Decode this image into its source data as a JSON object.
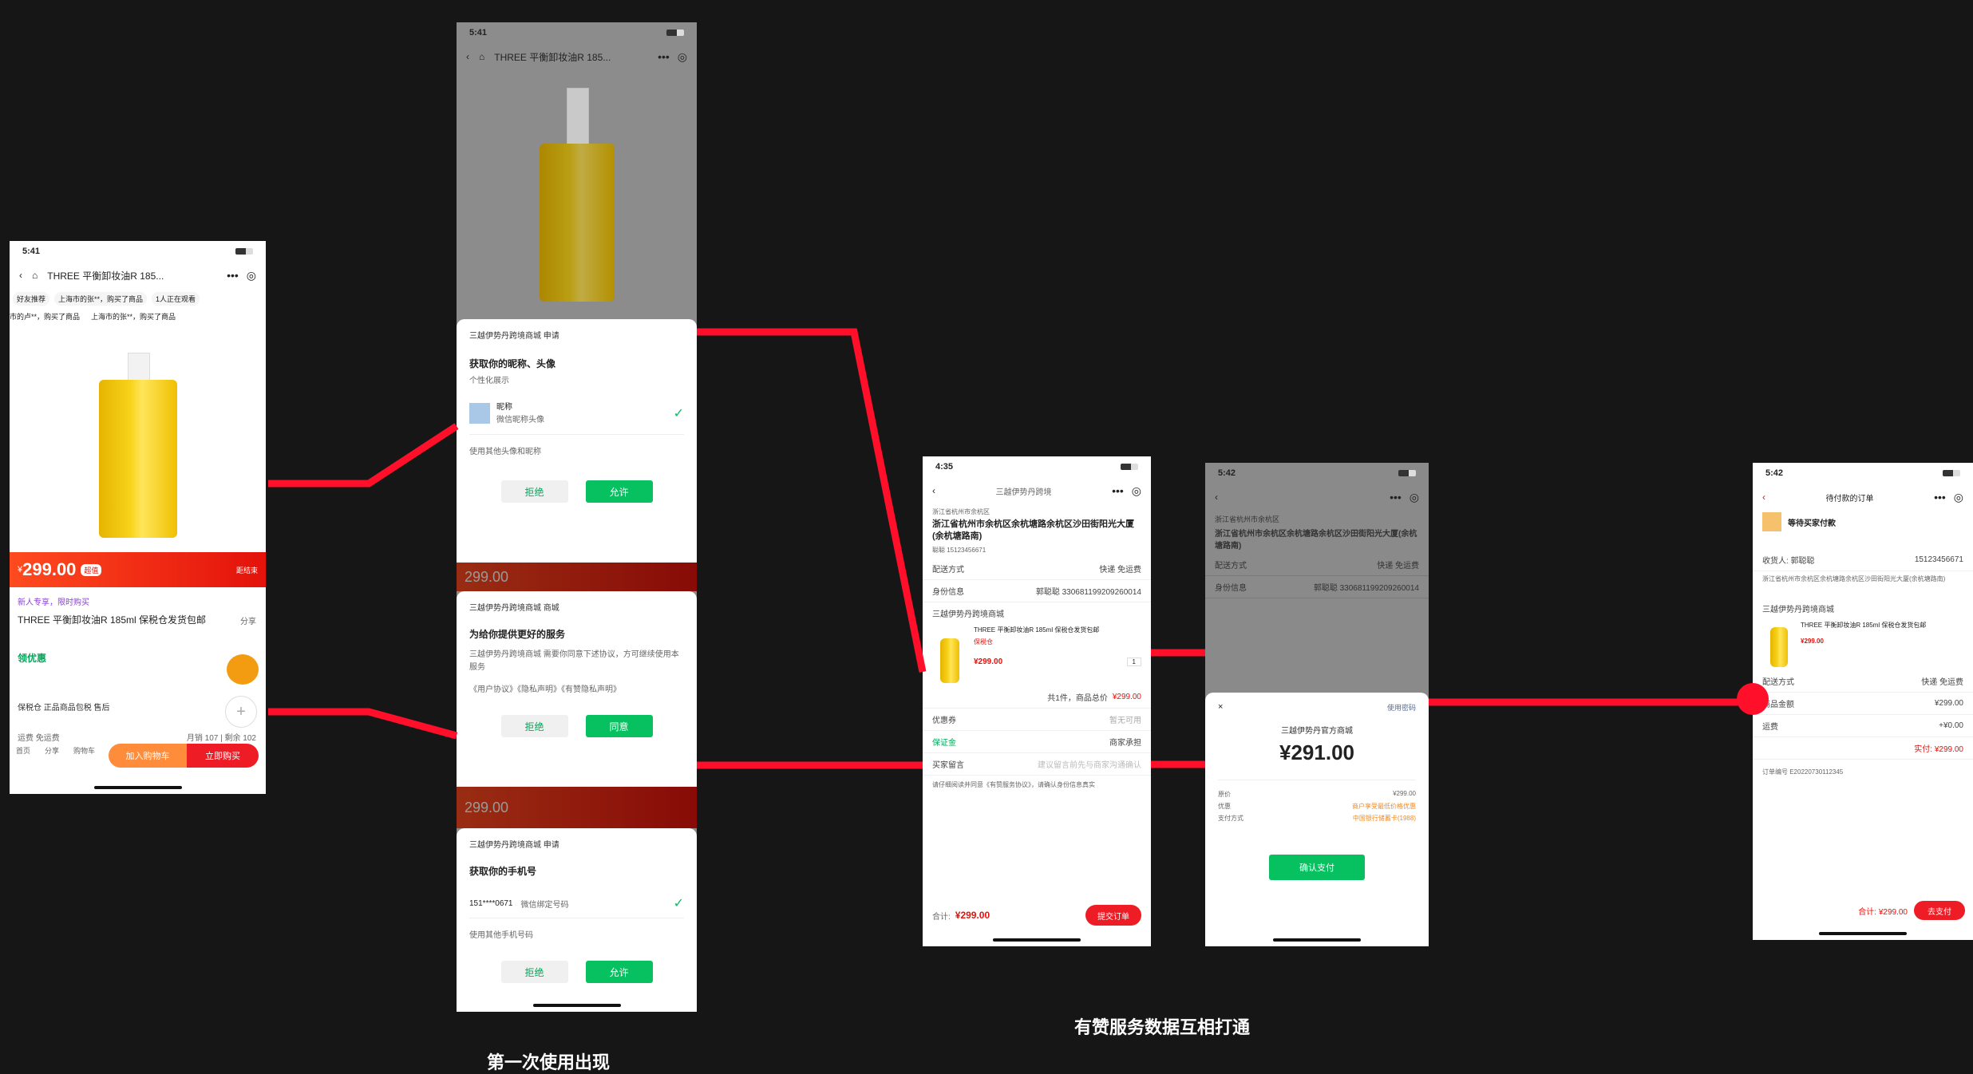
{
  "captions": {
    "first_use": "第一次使用出现",
    "data_sync": "有赞服务数据互相打通"
  },
  "colors": {
    "background": "#161616",
    "connector": "#ff0f2a",
    "brand_red": "#ee1c25",
    "wechat_green": "#07c160"
  },
  "product_page": {
    "time": "5:41",
    "title": "THREE 平衡卸妆油R 185...",
    "tags": [
      "好友推荐",
      "上海市的张**，购买了商品",
      "1人正在观看"
    ],
    "tags2": [
      "市的卢**，购买了商品",
      "上海市的张**，购买了商品"
    ],
    "price": "299.00",
    "price_badge": "超值",
    "countdown": "距结束",
    "product_name": "THREE 平衡卸妆油R 185ml 保税仓发货包邮",
    "share": "分享",
    "promo_label": "新人专享，限时购买",
    "coupon": "领优惠",
    "service": "保税仓 正品商品包税 售后",
    "express": "运费 免运费",
    "stats": "月销 107 | 剩余 102",
    "add_cart": "加入购物车",
    "buy_now": "立即购买",
    "bottom_icons": [
      "首页",
      "分享",
      "购物车"
    ]
  },
  "auth_sheet1": {
    "shop": "三越伊势丹跨境商城 申请",
    "title": "获取你的昵称、头像",
    "subtitle": "个性化展示",
    "user_name": "昵称",
    "user_desc": "微信昵称头像",
    "other": "使用其他头像和昵称",
    "deny": "拒绝",
    "allow": "允许"
  },
  "auth_sheet2": {
    "shop": "三越伊势丹跨境商城 商城",
    "title": "为给你提供更好的服务",
    "desc": "三越伊势丹跨境商城 需要你同意下述协议，方可继续使用本服务",
    "links": "《用户协议》《隐私声明》《有赞隐私声明》",
    "deny": "拒绝",
    "allow": "同意"
  },
  "auth_sheet3": {
    "shop": "三越伊势丹跨境商城 申请",
    "title": "获取你的手机号",
    "phone": "151****0671",
    "phone_note": "微信绑定号码",
    "other": "使用其他手机号码",
    "deny": "拒绝",
    "allow": "允许"
  },
  "order_page": {
    "time": "4:35",
    "title": "三越伊势丹跨境",
    "addr_small": "浙江省杭州市余杭区",
    "address": "浙江省杭州市余杭区余杭塘路余杭区沙田街阳光大厦(余杭塘路南)",
    "contact": "聪聪 15123456671",
    "delivery_label": "配送方式",
    "delivery_value": "快递 免运费",
    "id_label": "身份信息",
    "id_value": "郭聪聪 330681199209260014",
    "shop_name": "三越伊势丹跨境商城",
    "item_name": "THREE 平衡卸妆油R 185ml 保税仓发货包邮",
    "item_tag": "保税仓",
    "item_price": "¥299.00",
    "qty": "1",
    "sub_total_label": "共1件，商品总价",
    "sub_total": "¥299.00",
    "coupon_label": "优惠券",
    "coupon_value": "暂无可用",
    "dispatch_label": "保证金",
    "dispatch_value": "商家承担",
    "remark_label": "买家留言",
    "remark_placeholder": "建议留言前先与商家沟通确认",
    "agreement": "请仔细阅读并同意《有赞服务协议》，请确认身份信息真实",
    "total_label": "合计:",
    "total": "¥299.00",
    "submit": "提交订单"
  },
  "pay_page": {
    "time": "5:42",
    "merchant": "三越伊势丹官方商城",
    "amount": "¥291.00",
    "close": "×",
    "help": "使用密码",
    "lines": [
      {
        "label": "原价",
        "value": "¥299.00"
      },
      {
        "label": "优惠",
        "value": "商户享受最低价格优惠"
      },
      {
        "label": "支付方式",
        "value": "中国银行储蓄卡(1988)"
      }
    ],
    "confirm": "确认支付"
  },
  "pending_page": {
    "time": "5:42",
    "title": "待付款的订单",
    "notice": "等待买家付款",
    "buyer": "收货人: 郭聪聪",
    "buyer_phone": "15123456671",
    "shop_name": "三越伊势丹跨境商城",
    "item_name": "THREE 平衡卸妆油R 185ml 保税仓发货包邮",
    "item_price": "¥299.00",
    "rows": [
      {
        "label": "配送方式",
        "value": "快递 免运费"
      },
      {
        "label": "商品金额",
        "value": "¥299.00"
      },
      {
        "label": "运费",
        "value": "+¥0.00"
      }
    ],
    "total": "实付: ¥299.00",
    "order_no": "订单编号 E20220730112345",
    "pay_total": "合计: ¥299.00",
    "pay_btn": "去支付"
  }
}
